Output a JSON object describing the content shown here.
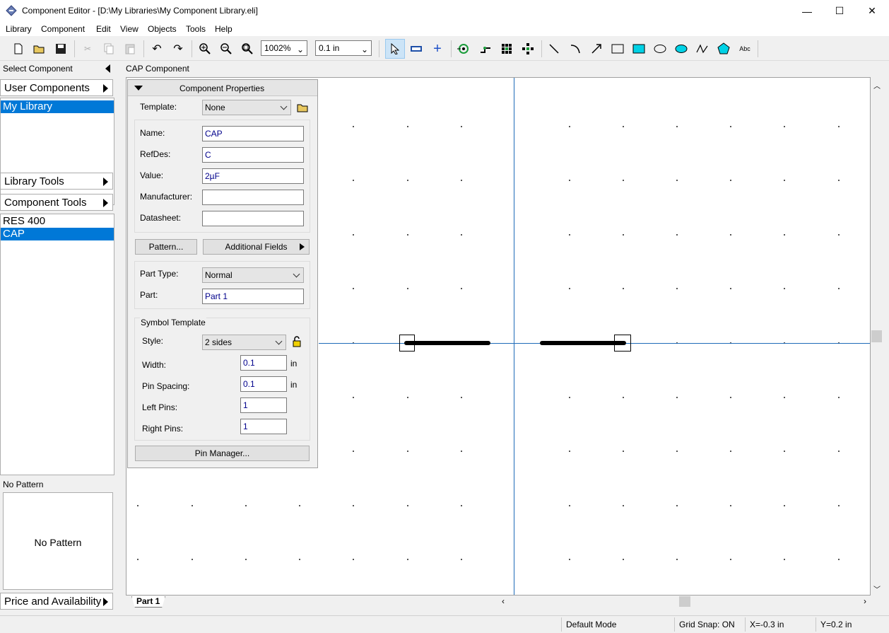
{
  "window": {
    "title": "Component Editor - [D:\\My Libraries\\My Component Library.eli]",
    "controls": {
      "minimize": "—",
      "maximize": "☐",
      "close": "✕"
    }
  },
  "menu": [
    "Library",
    "Component",
    "Edit",
    "View",
    "Objects",
    "Tools",
    "Help"
  ],
  "toolbar": {
    "zoom": "1002%",
    "grid": "0.1 in",
    "text_tool_label": "Abc",
    "accent_fill": "#00d2e6",
    "icons": [
      "new-file-icon",
      "open-folder-icon",
      "save-icon",
      "cut-icon",
      "copy-icon",
      "paste-icon",
      "undo-icon",
      "redo-icon",
      "zoom-in-icon",
      "zoom-out-icon",
      "zoom-fit-icon",
      "select-pointer-icon",
      "measure-icon",
      "crosshair-icon",
      "pin-icon",
      "wire-icon",
      "grid-pins-icon",
      "move-pins-icon",
      "line-icon",
      "arc-icon",
      "arrow-icon",
      "rectangle-icon",
      "filled-rectangle-icon",
      "ellipse-icon",
      "filled-ellipse-icon",
      "polyline-icon",
      "polygon-icon",
      "text-icon"
    ]
  },
  "left_panel": {
    "header": "Select Component",
    "user_components": "User Components",
    "libraries": [
      "My Library"
    ],
    "selected_library": 0,
    "library_tools": "Library Tools",
    "component_tools": "Component Tools",
    "components": [
      "RES 400",
      "CAP"
    ],
    "selected_component": 1,
    "pattern_header": "No Pattern",
    "pattern_preview": "No Pattern",
    "price_availability": "Price and Availability"
  },
  "canvas": {
    "title": "CAP Component",
    "tab": "Part 1"
  },
  "properties": {
    "header": "Component Properties",
    "template_label": "Template:",
    "template_value": "None",
    "name_label": "Name:",
    "name_value": "CAP",
    "refdes_label": "RefDes:",
    "refdes_value": "C",
    "value_label": "Value:",
    "value_value": "2µF",
    "manufacturer_label": "Manufacturer:",
    "manufacturer_value": "",
    "datasheet_label": "Datasheet:",
    "datasheet_value": "",
    "pattern_button": "Pattern...",
    "additional_fields_button": "Additional Fields",
    "part_type_label": "Part Type:",
    "part_type_value": "Normal",
    "part_label": "Part:",
    "part_value": "Part 1",
    "symbol_template_label": "Symbol Template",
    "style_label": "Style:",
    "style_value": "2 sides",
    "width_label": "Width:",
    "width_value": "0.1",
    "width_unit": "in",
    "pin_spacing_label": "Pin Spacing:",
    "pin_spacing_value": "0.1",
    "pin_spacing_unit": "in",
    "left_pins_label": "Left Pins:",
    "left_pins_value": "1",
    "right_pins_label": "Right Pins:",
    "right_pins_value": "1",
    "pin_manager_button": "Pin Manager..."
  },
  "status": {
    "mode": "Default Mode",
    "grid_snap": "Grid Snap: ON",
    "x": "X=-0.3 in",
    "y": "Y=0.2 in"
  }
}
